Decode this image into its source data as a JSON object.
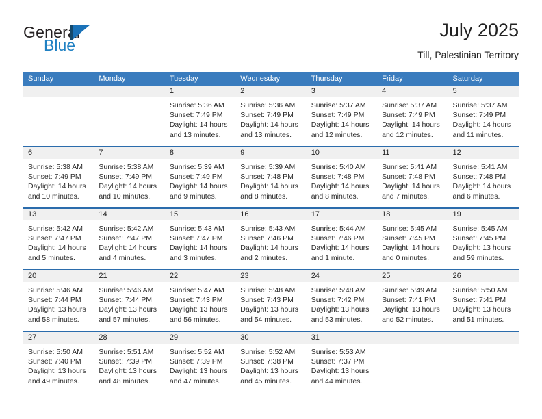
{
  "logo": {
    "word_one": "General",
    "word_two": "Blue",
    "flag_color": "#1a72b8",
    "pole_color": "#15496b",
    "text_color": "#231f20",
    "blue_text_color": "#2081c3"
  },
  "header": {
    "title": "July 2025",
    "subtitle": "Till, Palestinian Territory"
  },
  "theme": {
    "header_blue": "#3a7cbe",
    "divider_blue": "#2b6cac",
    "daynum_band": "#f0f0f0"
  },
  "weekdays": [
    "Sunday",
    "Monday",
    "Tuesday",
    "Wednesday",
    "Thursday",
    "Friday",
    "Saturday"
  ],
  "weeks": [
    [
      {
        "day": "",
        "sunrise": "",
        "sunset": "",
        "daylight_1": "",
        "daylight_2": ""
      },
      {
        "day": "",
        "sunrise": "",
        "sunset": "",
        "daylight_1": "",
        "daylight_2": ""
      },
      {
        "day": "1",
        "sunrise": "Sunrise: 5:36 AM",
        "sunset": "Sunset: 7:49 PM",
        "daylight_1": "Daylight: 14 hours",
        "daylight_2": "and 13 minutes."
      },
      {
        "day": "2",
        "sunrise": "Sunrise: 5:36 AM",
        "sunset": "Sunset: 7:49 PM",
        "daylight_1": "Daylight: 14 hours",
        "daylight_2": "and 13 minutes."
      },
      {
        "day": "3",
        "sunrise": "Sunrise: 5:37 AM",
        "sunset": "Sunset: 7:49 PM",
        "daylight_1": "Daylight: 14 hours",
        "daylight_2": "and 12 minutes."
      },
      {
        "day": "4",
        "sunrise": "Sunrise: 5:37 AM",
        "sunset": "Sunset: 7:49 PM",
        "daylight_1": "Daylight: 14 hours",
        "daylight_2": "and 12 minutes."
      },
      {
        "day": "5",
        "sunrise": "Sunrise: 5:37 AM",
        "sunset": "Sunset: 7:49 PM",
        "daylight_1": "Daylight: 14 hours",
        "daylight_2": "and 11 minutes."
      }
    ],
    [
      {
        "day": "6",
        "sunrise": "Sunrise: 5:38 AM",
        "sunset": "Sunset: 7:49 PM",
        "daylight_1": "Daylight: 14 hours",
        "daylight_2": "and 10 minutes."
      },
      {
        "day": "7",
        "sunrise": "Sunrise: 5:38 AM",
        "sunset": "Sunset: 7:49 PM",
        "daylight_1": "Daylight: 14 hours",
        "daylight_2": "and 10 minutes."
      },
      {
        "day": "8",
        "sunrise": "Sunrise: 5:39 AM",
        "sunset": "Sunset: 7:49 PM",
        "daylight_1": "Daylight: 14 hours",
        "daylight_2": "and 9 minutes."
      },
      {
        "day": "9",
        "sunrise": "Sunrise: 5:39 AM",
        "sunset": "Sunset: 7:48 PM",
        "daylight_1": "Daylight: 14 hours",
        "daylight_2": "and 8 minutes."
      },
      {
        "day": "10",
        "sunrise": "Sunrise: 5:40 AM",
        "sunset": "Sunset: 7:48 PM",
        "daylight_1": "Daylight: 14 hours",
        "daylight_2": "and 8 minutes."
      },
      {
        "day": "11",
        "sunrise": "Sunrise: 5:41 AM",
        "sunset": "Sunset: 7:48 PM",
        "daylight_1": "Daylight: 14 hours",
        "daylight_2": "and 7 minutes."
      },
      {
        "day": "12",
        "sunrise": "Sunrise: 5:41 AM",
        "sunset": "Sunset: 7:48 PM",
        "daylight_1": "Daylight: 14 hours",
        "daylight_2": "and 6 minutes."
      }
    ],
    [
      {
        "day": "13",
        "sunrise": "Sunrise: 5:42 AM",
        "sunset": "Sunset: 7:47 PM",
        "daylight_1": "Daylight: 14 hours",
        "daylight_2": "and 5 minutes."
      },
      {
        "day": "14",
        "sunrise": "Sunrise: 5:42 AM",
        "sunset": "Sunset: 7:47 PM",
        "daylight_1": "Daylight: 14 hours",
        "daylight_2": "and 4 minutes."
      },
      {
        "day": "15",
        "sunrise": "Sunrise: 5:43 AM",
        "sunset": "Sunset: 7:47 PM",
        "daylight_1": "Daylight: 14 hours",
        "daylight_2": "and 3 minutes."
      },
      {
        "day": "16",
        "sunrise": "Sunrise: 5:43 AM",
        "sunset": "Sunset: 7:46 PM",
        "daylight_1": "Daylight: 14 hours",
        "daylight_2": "and 2 minutes."
      },
      {
        "day": "17",
        "sunrise": "Sunrise: 5:44 AM",
        "sunset": "Sunset: 7:46 PM",
        "daylight_1": "Daylight: 14 hours",
        "daylight_2": "and 1 minute."
      },
      {
        "day": "18",
        "sunrise": "Sunrise: 5:45 AM",
        "sunset": "Sunset: 7:45 PM",
        "daylight_1": "Daylight: 14 hours",
        "daylight_2": "and 0 minutes."
      },
      {
        "day": "19",
        "sunrise": "Sunrise: 5:45 AM",
        "sunset": "Sunset: 7:45 PM",
        "daylight_1": "Daylight: 13 hours",
        "daylight_2": "and 59 minutes."
      }
    ],
    [
      {
        "day": "20",
        "sunrise": "Sunrise: 5:46 AM",
        "sunset": "Sunset: 7:44 PM",
        "daylight_1": "Daylight: 13 hours",
        "daylight_2": "and 58 minutes."
      },
      {
        "day": "21",
        "sunrise": "Sunrise: 5:46 AM",
        "sunset": "Sunset: 7:44 PM",
        "daylight_1": "Daylight: 13 hours",
        "daylight_2": "and 57 minutes."
      },
      {
        "day": "22",
        "sunrise": "Sunrise: 5:47 AM",
        "sunset": "Sunset: 7:43 PM",
        "daylight_1": "Daylight: 13 hours",
        "daylight_2": "and 56 minutes."
      },
      {
        "day": "23",
        "sunrise": "Sunrise: 5:48 AM",
        "sunset": "Sunset: 7:43 PM",
        "daylight_1": "Daylight: 13 hours",
        "daylight_2": "and 54 minutes."
      },
      {
        "day": "24",
        "sunrise": "Sunrise: 5:48 AM",
        "sunset": "Sunset: 7:42 PM",
        "daylight_1": "Daylight: 13 hours",
        "daylight_2": "and 53 minutes."
      },
      {
        "day": "25",
        "sunrise": "Sunrise: 5:49 AM",
        "sunset": "Sunset: 7:41 PM",
        "daylight_1": "Daylight: 13 hours",
        "daylight_2": "and 52 minutes."
      },
      {
        "day": "26",
        "sunrise": "Sunrise: 5:50 AM",
        "sunset": "Sunset: 7:41 PM",
        "daylight_1": "Daylight: 13 hours",
        "daylight_2": "and 51 minutes."
      }
    ],
    [
      {
        "day": "27",
        "sunrise": "Sunrise: 5:50 AM",
        "sunset": "Sunset: 7:40 PM",
        "daylight_1": "Daylight: 13 hours",
        "daylight_2": "and 49 minutes."
      },
      {
        "day": "28",
        "sunrise": "Sunrise: 5:51 AM",
        "sunset": "Sunset: 7:39 PM",
        "daylight_1": "Daylight: 13 hours",
        "daylight_2": "and 48 minutes."
      },
      {
        "day": "29",
        "sunrise": "Sunrise: 5:52 AM",
        "sunset": "Sunset: 7:39 PM",
        "daylight_1": "Daylight: 13 hours",
        "daylight_2": "and 47 minutes."
      },
      {
        "day": "30",
        "sunrise": "Sunrise: 5:52 AM",
        "sunset": "Sunset: 7:38 PM",
        "daylight_1": "Daylight: 13 hours",
        "daylight_2": "and 45 minutes."
      },
      {
        "day": "31",
        "sunrise": "Sunrise: 5:53 AM",
        "sunset": "Sunset: 7:37 PM",
        "daylight_1": "Daylight: 13 hours",
        "daylight_2": "and 44 minutes."
      },
      {
        "day": "",
        "sunrise": "",
        "sunset": "",
        "daylight_1": "",
        "daylight_2": ""
      },
      {
        "day": "",
        "sunrise": "",
        "sunset": "",
        "daylight_1": "",
        "daylight_2": ""
      }
    ]
  ]
}
